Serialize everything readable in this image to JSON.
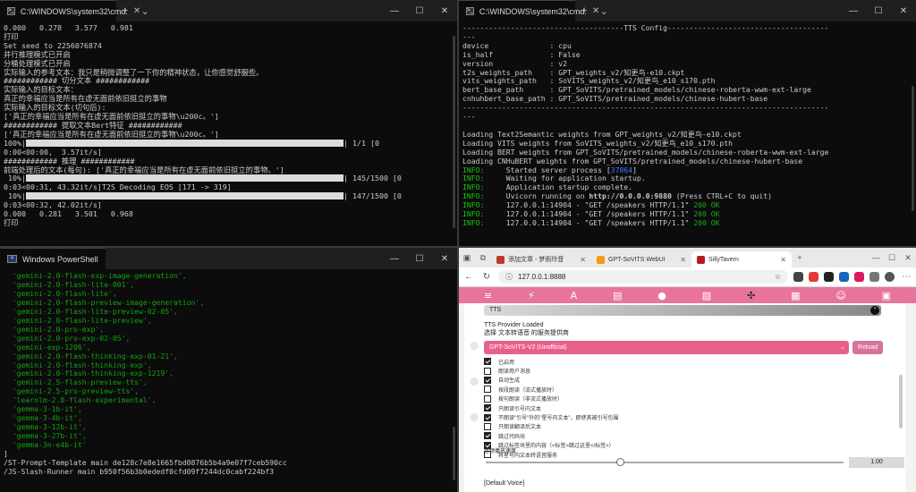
{
  "top_left": {
    "title": "C:\\WINDOWS\\system32\\cmd.",
    "lines": [
      "0.000   0.278   3.577   0.981",
      "打印",
      "Set seed to 2256076874",
      "并行推理模式已开启",
      "分桶处理模式已开启",
      "实际输入的参考文本：我只是稍微调整了一下你的精神状态，让你感觉舒服些。",
      "############ 切分文本 ############",
      "实际输入的目标文本：",
      "真正的幸福应当是所有在虚无面前依旧挺立的事物",
      "实际输入的目标文本(切句后):",
      "['真正的幸福应当是所有在虚无面前依旧挺立的事物\\u200c。']",
      "############ 提取文本Bert特征 ############",
      "['真正的幸福应当是所有在虚无面前依旧挺立的事物\\u200c。']"
    ],
    "progress1_prefix": "100%|",
    "progress1_value": 1.0,
    "progress1_suffix": "| 1/1 [0",
    "line_after1": "0:00<00:00,  3.57it/s]",
    "line_infer": "############ 推理 ############",
    "line_preproc": "前端处理后的文本(每句): ['真正的幸福应当是所有在虚无面前依旧挺立的事物。']",
    "progress2_prefix": " 10%|",
    "progress2_value": 0.097,
    "progress2_suffix": "| 145/1500 [0",
    "line_after2": "0:03<00:31, 43.32it/s]T2S Decoding EOS [171 -> 319]",
    "progress3_prefix": " 10%|",
    "progress3_value": 0.098,
    "progress3_suffix": "| 147/1500 [0",
    "line_after3": "0:03<00:32, 42.02it/s]",
    "line_final": "0.000   0.281   3.501   0.968",
    "line_print": "打印"
  },
  "top_right": {
    "title": "C:\\WINDOWS\\system32\\cmd.",
    "config_header": "-------------------------------------TTS Config-------------------------------------",
    "dash_short": "---",
    "config": [
      "device              : cpu",
      "is_half             : False",
      "version             : v2",
      "t2s_weights_path    : GPT_weights_v2/知更鸟-e10.ckpt",
      "vits_weights_path   : SoVITS_weights_v2/知更鸟_e10_s170.pth",
      "bert_base_path      : GPT_SoVITS/pretrained_models/chinese-roberta-wwm-ext-large",
      "cnhuhbert_base_path : GPT_SoVITS/pretrained_models/chinese-hubert-base"
    ],
    "config_footer": "------------------------------------------------------------------------------------",
    "loading": [
      "Loading Text2Semantic weights from GPT_weights_v2/知更鸟-e10.ckpt",
      "Loading VITS weights from SoVITS_weights_v2/知更鸟_e10_s170.pth",
      "Loading BERT weights from GPT_SoVITS/pretrained_models/chinese-roberta-wwm-ext-large",
      "Loading CNHuBERT weights from GPT_SoVITS/pretrained_models/chinese-hubert-base"
    ],
    "info_label": "INFO:",
    "started_prefix": "     Started server process [",
    "pid": "37864",
    "started_suffix": "]",
    "waiting": "     Waiting for application startup.",
    "complete": "     Application startup complete.",
    "uvicorn_prefix": "     Uvicorn running on ",
    "uvicorn_url": "http://0.0.0.0:9880",
    "uvicorn_suffix": " (Press CTRL+C to quit)",
    "request": "     127.0.0.1:14904 - \"GET /speakers HTTP/1.1\" ",
    "ok": "200 OK"
  },
  "bottom_left": {
    "title": "Windows PowerShell",
    "models": [
      "  'gemini-2.0-flash-exp-image-generation',",
      "  'gemini-2.0-flash-lite-001',",
      "  'gemini-2.0-flash-lite',",
      "  'gemini-2.0-flash-preview-image-generation',",
      "  'gemini-2.0-flash-lite-preview-02-05',",
      "  'gemini-2.0-flash-lite-preview',",
      "  'gemini-2.0-pro-exp',",
      "  'gemini-2.0-pro-exp-02-05',",
      "  'gemini-exp-1206',",
      "  'gemini-2.0-flash-thinking-exp-01-21',",
      "  'gemini-2.0-flash-thinking-exp',",
      "  'gemini-2.0-flash-thinking-exp-1219',",
      "  'gemini-2.5-flash-preview-tts',",
      "  'gemini-2.5-pro-preview-tts',",
      "  'learnlm-2.0-flash-experimental',",
      "  'gemma-3-1b-it',",
      "  'gemma-3-4b-it',",
      "  'gemma-3-12b-it',",
      "  'gemma-3-27b-it',",
      "  'gemma-3n-e4b-it'"
    ],
    "close_bracket": "]",
    "repo1": "/ST-Prompt-Template main de128c7e8e1665fbd0876b5b4a9e07f7ceb590cc",
    "repo2": "/JS-Slash-Runner main b950f56b3b0ededf0cfd09f7244dc0cabf224bf3"
  },
  "browser": {
    "tabs": [
      {
        "label": "添加文章 - 梦雨玲音",
        "color": "#c0392b"
      },
      {
        "label": "GPT-SoVITS WebUI",
        "color": "#f39c12"
      },
      {
        "label": "SillyTavern",
        "color": "#b71c1c"
      }
    ],
    "address": "127.0.0.1:8888",
    "tts_header": "TTS",
    "provider_loaded": "TTS Provider Loaded",
    "provider_select_label": "选择 文本转语音 的服务提供商",
    "provider_selected": "GPT-SoVITS-V2 (Unofficial)",
    "reload_label": "Reload",
    "options": [
      {
        "label": "已启用",
        "checked": true
      },
      {
        "label": "朗读用户消息",
        "checked": false
      },
      {
        "label": "自动生成",
        "checked": true
      },
      {
        "label": "按段朗读（流式播放时）",
        "checked": false
      },
      {
        "label": "按句朗读（非流式播放时）",
        "checked": false
      },
      {
        "label": "只朗读引号内文本",
        "checked": true
      },
      {
        "label": "不朗读\"引号\"外的\"星号内文本\"，即使其被引号包围",
        "checked": true
      },
      {
        "label": "只朗读翻译后文本",
        "checked": false
      },
      {
        "label": "跳过代码块",
        "checked": true
      },
      {
        "label": "跳过标签块里的内容（<标签>跳过这里</标签>）",
        "checked": true
      },
      {
        "label": "将星号内文本转语音服务",
        "checked": false
      }
    ],
    "speed_label": "音频播放速度",
    "speed_value": "1.00",
    "speed_fraction": 0.375,
    "default_voice": "[Default Voice]"
  }
}
